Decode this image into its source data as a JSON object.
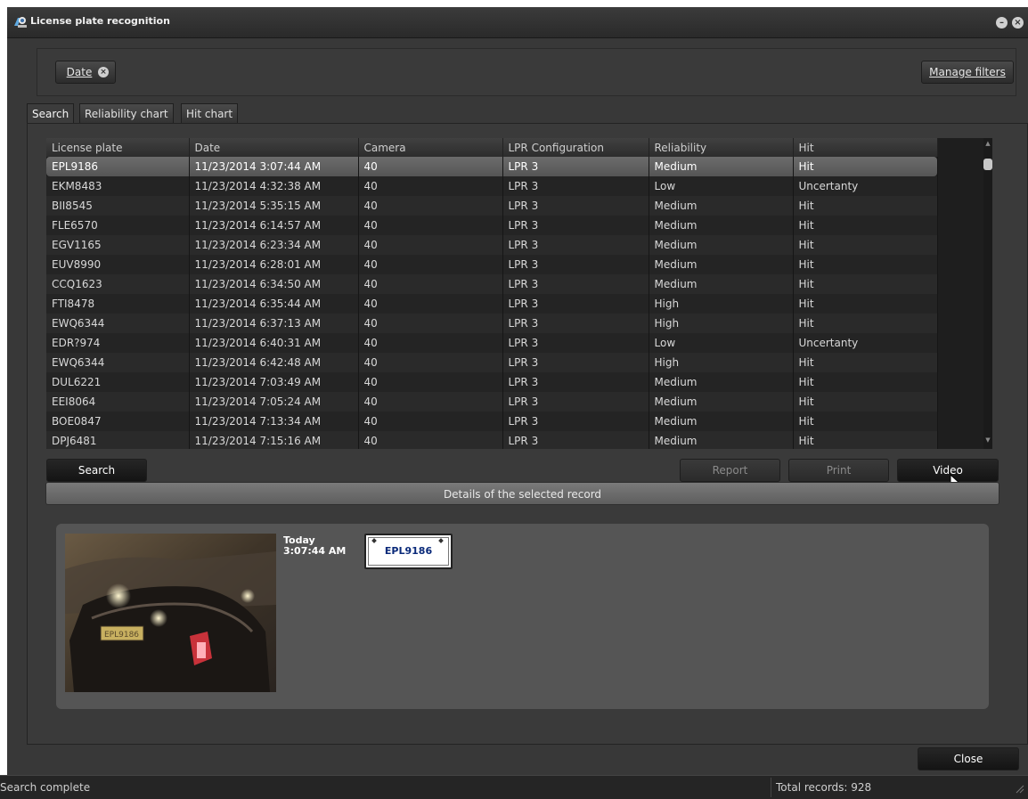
{
  "window": {
    "title": "License plate recognition"
  },
  "filters": {
    "date_chip": "Date",
    "manage_filters": "Manage filters"
  },
  "tabs": [
    {
      "label": "Search",
      "active": true
    },
    {
      "label": "Reliability chart",
      "active": false
    },
    {
      "label": "Hit chart",
      "active": false
    }
  ],
  "table": {
    "columns": [
      "License plate",
      "Date",
      "Camera",
      "LPR Configuration",
      "Reliability",
      "Hit"
    ],
    "selected_index": 0,
    "rows": [
      [
        "EPL9186",
        "11/23/2014 3:07:44 AM",
        "40",
        "LPR 3",
        "Medium",
        "Hit"
      ],
      [
        "EKM8483",
        "11/23/2014 4:32:38 AM",
        "40",
        "LPR 3",
        "Low",
        "Uncertanty"
      ],
      [
        "BII8545",
        "11/23/2014 5:35:15 AM",
        "40",
        "LPR 3",
        "Medium",
        "Hit"
      ],
      [
        "FLE6570",
        "11/23/2014 6:14:57 AM",
        "40",
        "LPR 3",
        "Medium",
        "Hit"
      ],
      [
        "EGV1165",
        "11/23/2014 6:23:34 AM",
        "40",
        "LPR 3",
        "Medium",
        "Hit"
      ],
      [
        "EUV8990",
        "11/23/2014 6:28:01 AM",
        "40",
        "LPR 3",
        "Medium",
        "Hit"
      ],
      [
        "CCQ1623",
        "11/23/2014 6:34:50 AM",
        "40",
        "LPR 3",
        "Medium",
        "Hit"
      ],
      [
        "FTI8478",
        "11/23/2014 6:35:44 AM",
        "40",
        "LPR 3",
        "High",
        "Hit"
      ],
      [
        "EWQ6344",
        "11/23/2014 6:37:13 AM",
        "40",
        "LPR 3",
        "High",
        "Hit"
      ],
      [
        "EDR?974",
        "11/23/2014 6:40:31 AM",
        "40",
        "LPR 3",
        "Low",
        "Uncertanty"
      ],
      [
        "EWQ6344",
        "11/23/2014 6:42:48 AM",
        "40",
        "LPR 3",
        "High",
        "Hit"
      ],
      [
        "DUL6221",
        "11/23/2014 7:03:49 AM",
        "40",
        "LPR 3",
        "Medium",
        "Hit"
      ],
      [
        "EEI8064",
        "11/23/2014 7:05:24 AM",
        "40",
        "LPR 3",
        "Medium",
        "Hit"
      ],
      [
        "BOE0847",
        "11/23/2014 7:13:34 AM",
        "40",
        "LPR 3",
        "Medium",
        "Hit"
      ],
      [
        "DPJ6481",
        "11/23/2014 7:15:16 AM",
        "40",
        "LPR 3",
        "Medium",
        "Hit"
      ]
    ]
  },
  "buttons": {
    "search": "Search",
    "report": "Report",
    "print": "Print",
    "video": "Video",
    "close": "Close"
  },
  "details": {
    "header": "Details of the selected record",
    "day": "Today",
    "time": "3:07:44 AM",
    "plate": "EPL9186",
    "snapshot_plate": "EPL9186"
  },
  "status": {
    "message": "Search complete",
    "total_records": "Total records: 928"
  },
  "icons": {
    "app": "camera-lpr-icon",
    "minimize": "minimize-icon",
    "close": "close-icon",
    "chip_remove": "remove-filter-icon",
    "cursor": "mouse-pointer-icon",
    "resize": "resize-grip-icon"
  },
  "colors": {
    "selected_row": "#606060",
    "background": "#383838",
    "plate_text": "#0a2a7a"
  }
}
